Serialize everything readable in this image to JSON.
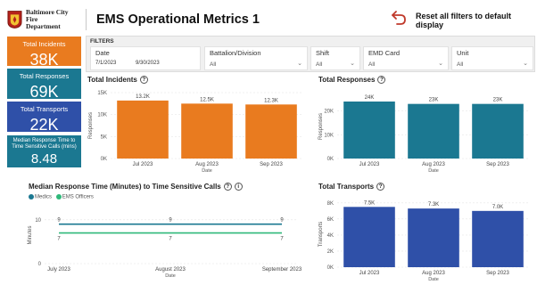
{
  "header": {
    "logo_line1": "Baltimore City Fire",
    "logo_line2": "Department",
    "title": "EMS Operational Metrics 1",
    "reset_label": "Reset all filters to default display",
    "reset_icon": "undo-arrow-icon",
    "accent_color": "#c0392b"
  },
  "kpis": {
    "incidents": {
      "label": "Total Incidents",
      "value": "38K",
      "color": "#e97b1f"
    },
    "responses": {
      "label": "Total Responses",
      "value": "69K",
      "color": "#1b7891"
    },
    "transports": {
      "label": "Total Transports",
      "value": "22K",
      "color": "#2f50a8"
    },
    "median": {
      "label": "Median Response Time to Time Sensitive Calls (mins)",
      "value": "8.48",
      "color": "#1b7891"
    }
  },
  "filters": {
    "title": "FILTERS",
    "date": {
      "label": "Date",
      "start": "7/1/2023",
      "end": "9/30/2023"
    },
    "battalion": {
      "label": "Battalion/Division",
      "value": "All"
    },
    "shift": {
      "label": "Shift",
      "value": "All"
    },
    "emd": {
      "label": "EMD Card",
      "value": "All"
    },
    "unit": {
      "label": "Unit",
      "value": "All"
    }
  },
  "chart_data": [
    {
      "id": "incidents",
      "type": "bar",
      "title": "Total Incidents",
      "categories": [
        "Jul 2023",
        "Aug 2023",
        "Sep 2023"
      ],
      "values": [
        13200,
        12500,
        12300
      ],
      "data_labels": [
        "13.2K",
        "12.5K",
        "12.3K"
      ],
      "xlabel": "Date",
      "ylabel": "Responses",
      "yticks": [
        "0K",
        "5K",
        "10K",
        "15K"
      ],
      "ylim": [
        0,
        15000
      ],
      "color": "#e97b1f"
    },
    {
      "id": "responses",
      "type": "bar",
      "title": "Total Responses",
      "categories": [
        "Jul 2023",
        "Aug 2023",
        "Sep 2023"
      ],
      "values": [
        24000,
        23000,
        23000
      ],
      "data_labels": [
        "24K",
        "23K",
        "23K"
      ],
      "xlabel": "Date",
      "ylabel": "Responses",
      "yticks": [
        "0K",
        "10K",
        "20K"
      ],
      "ylim": [
        0,
        27000
      ],
      "color": "#1b7891"
    },
    {
      "id": "median",
      "type": "line",
      "title": "Median Response Time (Minutes) to Time Sensitive Calls",
      "categories": [
        "July 2023",
        "August 2023",
        "September 2023"
      ],
      "series": [
        {
          "name": "Medics",
          "values": [
            9,
            9,
            9
          ],
          "labels": [
            "9",
            "9",
            "9"
          ],
          "color": "#1b7891"
        },
        {
          "name": "EMS Officers",
          "values": [
            7,
            7,
            7
          ],
          "labels": [
            "7",
            "7",
            "7"
          ],
          "color": "#2fb87a"
        }
      ],
      "xlabel": "Date",
      "ylabel": "Minutes",
      "yticks": [
        "0",
        "10"
      ],
      "ylim": [
        0,
        13
      ]
    },
    {
      "id": "transports",
      "type": "bar",
      "title": "Total Transports",
      "categories": [
        "Jul 2023",
        "Aug 2023",
        "Sep 2023"
      ],
      "values": [
        7500,
        7300,
        7000
      ],
      "data_labels": [
        "7.5K",
        "7.3K",
        "7.0K"
      ],
      "xlabel": "Date",
      "ylabel": "Transports",
      "yticks": [
        "0K",
        "2K",
        "4K",
        "6K",
        "8K"
      ],
      "ylim": [
        0,
        8200
      ],
      "color": "#2f50a8"
    }
  ]
}
